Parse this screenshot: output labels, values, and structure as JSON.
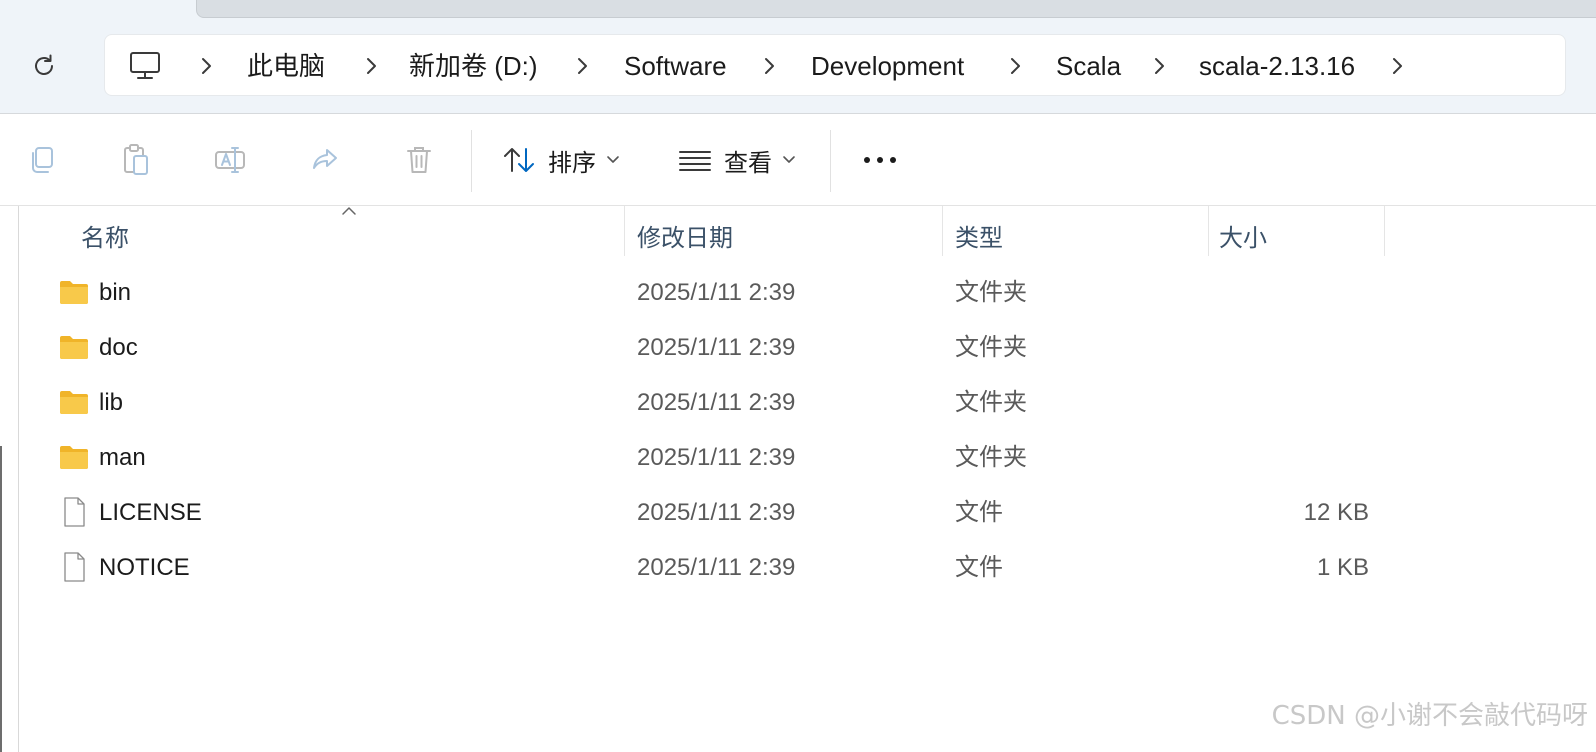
{
  "address_bar": {
    "breadcrumbs": [
      "此电脑",
      "新加卷 (D:)",
      "Software",
      "Development",
      "Scala",
      "scala-2.13.16"
    ]
  },
  "command_bar": {
    "sort_label": "排序",
    "view_label": "查看"
  },
  "columns": {
    "name": "名称",
    "modified": "修改日期",
    "type": "类型",
    "size": "大小"
  },
  "files": [
    {
      "name": "bin",
      "modified": "2025/1/11 2:39",
      "type": "文件夹",
      "size": "",
      "icon": "folder-icon"
    },
    {
      "name": "doc",
      "modified": "2025/1/11 2:39",
      "type": "文件夹",
      "size": "",
      "icon": "folder-icon"
    },
    {
      "name": "lib",
      "modified": "2025/1/11 2:39",
      "type": "文件夹",
      "size": "",
      "icon": "folder-icon"
    },
    {
      "name": "man",
      "modified": "2025/1/11 2:39",
      "type": "文件夹",
      "size": "",
      "icon": "folder-icon"
    },
    {
      "name": "LICENSE",
      "modified": "2025/1/11 2:39",
      "type": "文件",
      "size": "12 KB",
      "icon": "file-icon"
    },
    {
      "name": "NOTICE",
      "modified": "2025/1/11 2:39",
      "type": "文件",
      "size": "1 KB",
      "icon": "file-icon"
    }
  ],
  "watermark": "CSDN @小谢不会敲代码呀",
  "colors": {
    "accent": "#0067c0",
    "folder": "#f8c94a",
    "header_text": "#3b5168"
  }
}
